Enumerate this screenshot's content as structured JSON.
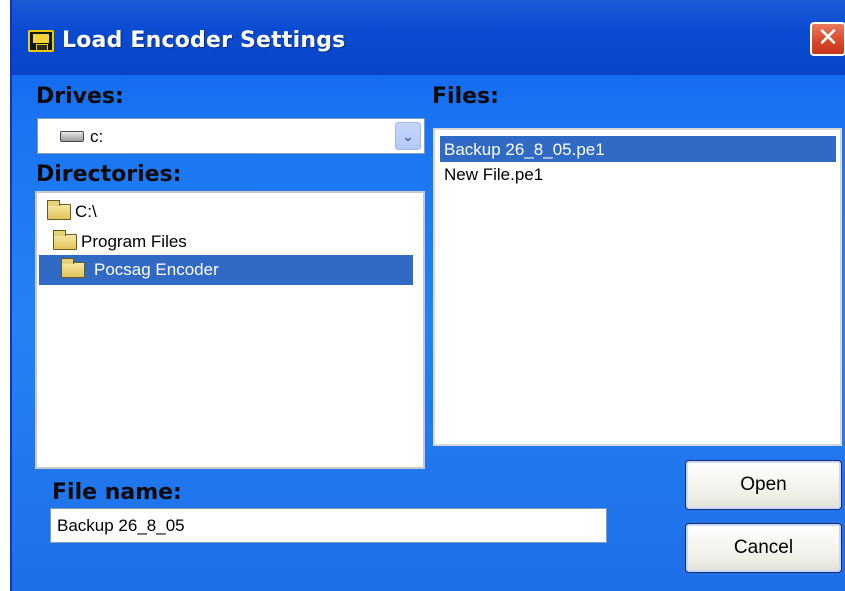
{
  "window": {
    "title": "Load Encoder Settings",
    "close_glyph": "✕",
    "title_icon": "floppy-disk-icon"
  },
  "drives": {
    "label": "Drives:",
    "selected": "c:",
    "icon": "drive-icon"
  },
  "directories": {
    "label": "Directories:",
    "items": [
      {
        "label": "C:\\",
        "selected": false
      },
      {
        "label": "Program Files",
        "selected": false
      },
      {
        "label": "Pocsag Encoder",
        "selected": true
      }
    ]
  },
  "files": {
    "label": "Files:",
    "items": [
      {
        "label": "Backup 26_8_05.pe1",
        "selected": true
      },
      {
        "label": "New File.pe1",
        "selected": false
      }
    ]
  },
  "file_name": {
    "label": "File name:",
    "value": "Backup 26_8_05"
  },
  "buttons": {
    "open": "Open",
    "cancel": "Cancel"
  },
  "colors": {
    "selection": "#316ac5",
    "window_blue": "#1a74f2",
    "close_red": "#d8462a"
  }
}
